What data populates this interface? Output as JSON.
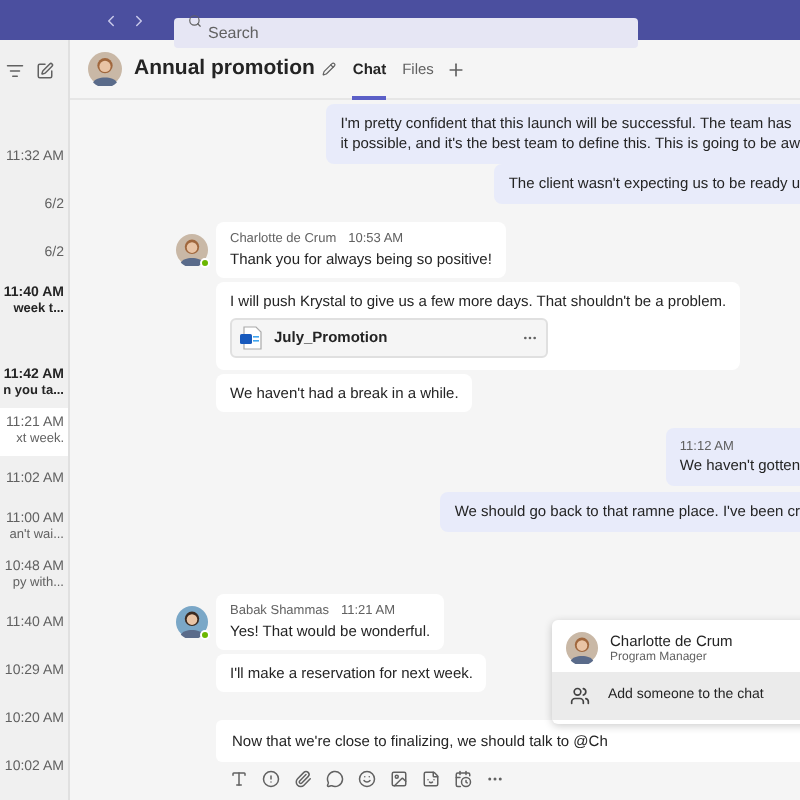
{
  "top_bar": {
    "search": {
      "placeholder": "Search"
    }
  },
  "sidebar": {
    "chats": [
      {
        "time": "11:32 AM",
        "unread": false,
        "selected": false
      },
      {
        "time": "6/2",
        "unread": false,
        "selected": false
      },
      {
        "time": "6/2",
        "unread": false,
        "selected": false
      },
      {
        "time": "11:40 AM",
        "preview": "week t...",
        "unread": true,
        "selected": false
      },
      {
        "time": "11:42 AM",
        "preview": "n you ta...",
        "unread": true,
        "selected": false
      },
      {
        "time": "11:21 AM",
        "preview": "xt week.",
        "unread": false,
        "selected": true
      },
      {
        "time": "11:02 AM",
        "unread": false,
        "selected": false
      },
      {
        "time": "11:00 AM",
        "preview": "an't wai...",
        "unread": false,
        "selected": false
      },
      {
        "time": "10:48 AM",
        "preview": "py with...",
        "unread": false,
        "selected": false
      },
      {
        "time": "11:40 AM",
        "unread": false,
        "selected": false
      },
      {
        "time": "10:29 AM",
        "unread": false,
        "selected": false
      },
      {
        "time": "10:20 AM",
        "unread": false,
        "selected": false
      },
      {
        "time": "10:02 AM",
        "unread": false,
        "selected": false
      }
    ]
  },
  "chat_header": {
    "title": "Annual promotion",
    "tabs": [
      {
        "label": "Chat",
        "selected": true
      },
      {
        "label": "Files",
        "selected": false
      }
    ]
  },
  "messages": [
    {
      "kind": "mine",
      "lines": [
        "I'm pretty confident that this launch will be successful. The team has",
        "it possible, and it's the best team to define this. This is going to be aw"
      ]
    },
    {
      "kind": "mine",
      "lines": [
        "The client wasn't expecting us to be ready u"
      ]
    },
    {
      "kind": "theirs",
      "author": "Charlotte de Crum",
      "time": "10:53 AM",
      "bubbles": [
        {
          "text": "Thank you for always being so positive!"
        },
        {
          "text": "I will push Krystal to give us a few more days. That shouldn't be a problem.",
          "file": "July_Promotion"
        },
        {
          "text": "We haven't had a break in a while."
        }
      ]
    },
    {
      "kind": "mine",
      "time": "11:12 AM",
      "lines": [
        "We haven't gotten"
      ]
    },
    {
      "kind": "mine",
      "lines": [
        "We should go back to that ramne place. I've been cr"
      ]
    },
    {
      "kind": "theirs",
      "author": "Babak Shammas",
      "time": "11:21 AM",
      "bubbles": [
        {
          "text": "Yes! That would be wonderful."
        },
        {
          "text": "I'll make a reservation for next week."
        }
      ]
    }
  ],
  "compose": {
    "value": "Now that we're close to finalizing, we should talk to @Ch"
  },
  "mention_popup": {
    "items": [
      {
        "kind": "person",
        "name": "Charlotte de Crum",
        "role": "Program Manager",
        "selected": false
      },
      {
        "kind": "action",
        "label": "Add someone to the chat",
        "selected": true
      }
    ]
  }
}
